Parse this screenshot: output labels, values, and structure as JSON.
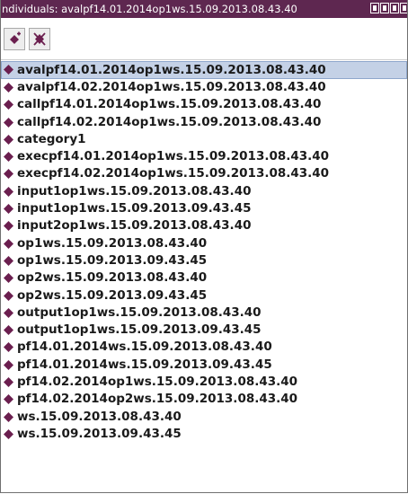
{
  "window": {
    "title": "ndividuals: avalpf14.01.2014op1ws.15.09.2013.08.43.40"
  },
  "toolbar": {
    "add_icon": "add-individual-icon",
    "delete_icon": "delete-individual-icon"
  },
  "colors": {
    "titlebar": "#5e2750",
    "diamond": "#6b1f4f",
    "selection": "#c4d1e6"
  },
  "list": {
    "selected_index": 0,
    "items": [
      "avalpf14.01.2014op1ws.15.09.2013.08.43.40",
      "avalpf14.02.2014op1ws.15.09.2013.08.43.40",
      "callpf14.01.2014op1ws.15.09.2013.08.43.40",
      "callpf14.02.2014op1ws.15.09.2013.08.43.40",
      "category1",
      "execpf14.01.2014op1ws.15.09.2013.08.43.40",
      "execpf14.02.2014op1ws.15.09.2013.08.43.40",
      "input1op1ws.15.09.2013.08.43.40",
      "input1op1ws.15.09.2013.09.43.45",
      "input2op1ws.15.09.2013.08.43.40",
      "op1ws.15.09.2013.08.43.40",
      "op1ws.15.09.2013.09.43.45",
      "op2ws.15.09.2013.08.43.40",
      "op2ws.15.09.2013.09.43.45",
      "output1op1ws.15.09.2013.08.43.40",
      "output1op1ws.15.09.2013.09.43.45",
      "pf14.01.2014ws.15.09.2013.08.43.40",
      "pf14.01.2014ws.15.09.2013.09.43.45",
      "pf14.02.2014op1ws.15.09.2013.08.43.40",
      "pf14.02.2014op2ws.15.09.2013.08.43.40",
      "ws.15.09.2013.08.43.40",
      "ws.15.09.2013.09.43.45"
    ]
  }
}
